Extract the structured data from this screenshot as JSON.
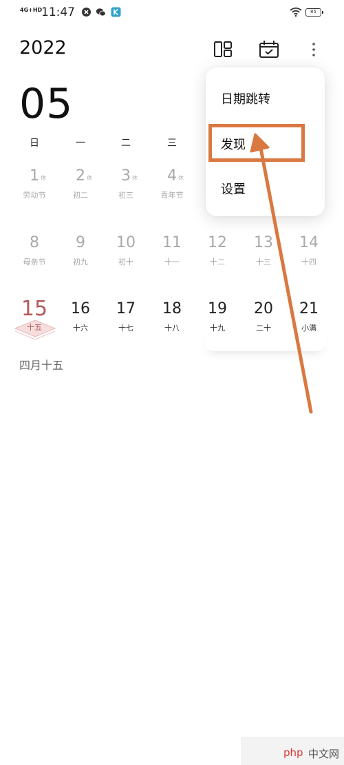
{
  "status_bar": {
    "network": "4G+HD",
    "time": "11:47",
    "battery": "85",
    "icons": [
      "mute-circle-icon",
      "wechat-icon",
      "app-k-icon",
      "wifi-icon",
      "battery-icon"
    ]
  },
  "header": {
    "year": "2022",
    "month": "05",
    "buttons": [
      "layout-icon",
      "calendar-check-icon",
      "more-icon"
    ]
  },
  "weekdays": [
    "日",
    "一",
    "二",
    "三"
  ],
  "weeks": [
    [
      {
        "day": "1",
        "sup": "休",
        "lunar": "劳动节",
        "style": "dim"
      },
      {
        "day": "2",
        "sup": "休",
        "lunar": "初二",
        "style": "dim"
      },
      {
        "day": "3",
        "sup": "休",
        "lunar": "初三",
        "style": "dim"
      },
      {
        "day": "4",
        "sup": "休",
        "lunar": "青年节",
        "style": "dim"
      }
    ],
    [
      {
        "day": "8",
        "lunar": "母亲节",
        "style": "dim"
      },
      {
        "day": "9",
        "lunar": "初九",
        "style": "dim"
      },
      {
        "day": "10",
        "lunar": "初十",
        "style": "dim"
      },
      {
        "day": "11",
        "lunar": "十一",
        "style": "dim"
      },
      {
        "day": "12",
        "lunar": "十二",
        "style": "dim"
      },
      {
        "day": "13",
        "lunar": "十三",
        "style": "dim"
      },
      {
        "day": "14",
        "lunar": "十四",
        "style": "dim"
      }
    ],
    [
      {
        "day": "15",
        "lunar": "十五",
        "style": "today"
      },
      {
        "day": "16",
        "lunar": "十六",
        "style": "cur"
      },
      {
        "day": "17",
        "lunar": "十七",
        "style": "cur"
      },
      {
        "day": "18",
        "lunar": "十八",
        "style": "cur"
      },
      {
        "day": "19",
        "lunar": "十九",
        "style": "cur"
      },
      {
        "day": "20",
        "lunar": "二十",
        "style": "cur"
      },
      {
        "day": "21",
        "lunar": "小满",
        "style": "cur"
      }
    ]
  ],
  "selected_lunar": "四月十五",
  "menu": {
    "items": [
      "日期跳转",
      "发现",
      "设置"
    ],
    "highlighted": "发现"
  },
  "colors": {
    "today": "#b25a5a",
    "annotation": "#d97840",
    "dim_text": "#a9a9a9"
  },
  "watermark": {
    "logo": "php",
    "text": "中文网"
  }
}
